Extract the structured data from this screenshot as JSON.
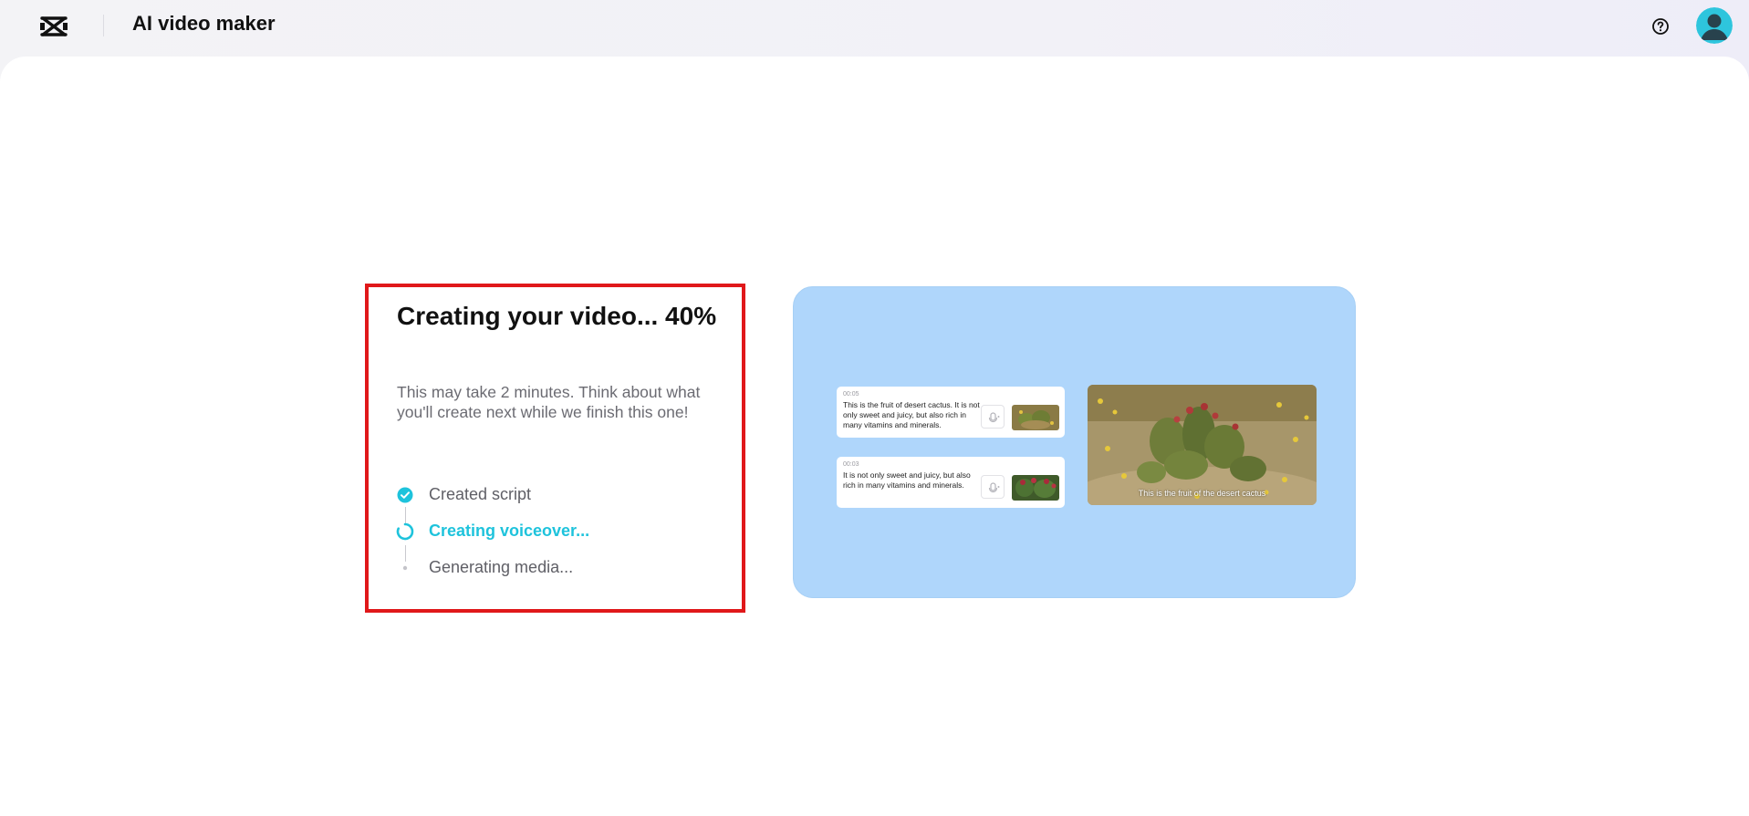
{
  "header": {
    "app_title": "AI video maker",
    "logo_icon": "capcut-logo-icon",
    "help_icon": "help-circle-icon",
    "avatar_icon": "user-avatar-icon"
  },
  "progress": {
    "title": "Creating your video... 40%",
    "percent": 40,
    "description": "This may take 2 minutes. Think about what you'll create next while we finish this one!",
    "steps": [
      {
        "label": "Created script",
        "status": "done",
        "icon": "check-circle-icon"
      },
      {
        "label": "Creating voiceover...",
        "status": "active",
        "icon": "spinner-icon"
      },
      {
        "label": "Generating media...",
        "status": "pending",
        "icon": "dot-icon"
      }
    ]
  },
  "preview": {
    "scenes": [
      {
        "time": "00:05",
        "text": "This is the fruit of desert cactus. It is not only sweet and juicy, but also rich in many vitamins and minerals."
      },
      {
        "time": "00:03",
        "text": "It is not only sweet and juicy, but also rich in many vitamins and minerals."
      }
    ],
    "video_caption": "This is the fruit of the desert cactus"
  },
  "colors": {
    "accent": "#1ec3dc",
    "highlight_border": "#e0181a",
    "preview_bg": "#afd6fb"
  }
}
